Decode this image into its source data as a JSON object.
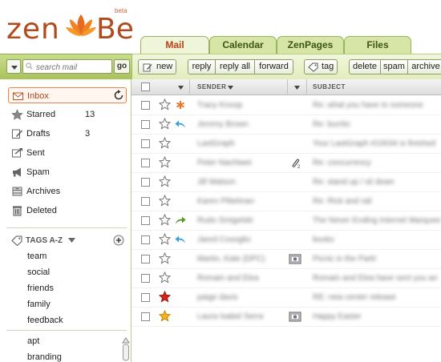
{
  "app": {
    "logo_text_left": "zen",
    "logo_text_right": "Be",
    "logo_badge": "beta",
    "accent_color": "#b5421c",
    "band_color": "#b3ca6a"
  },
  "tabs": [
    {
      "label": "Mail",
      "active": true
    },
    {
      "label": "Calendar",
      "active": false
    },
    {
      "label": "ZenPages",
      "active": false
    },
    {
      "label": "Files",
      "active": false
    }
  ],
  "search": {
    "placeholder": "search mail",
    "go_label": "go"
  },
  "toolbar": {
    "new_label": "new",
    "reply_label": "reply",
    "reply_all_label": "reply all",
    "forward_label": "forward",
    "tag_label": "tag",
    "delete_label": "delete",
    "spam_label": "spam",
    "archive_label": "archive"
  },
  "folders": [
    {
      "label": "Inbox",
      "count": "",
      "icon": "envelope-icon",
      "active": true
    },
    {
      "label": "Starred",
      "count": "13",
      "icon": "star-icon",
      "active": false
    },
    {
      "label": "Drafts",
      "count": "3",
      "icon": "pencil-icon",
      "active": false
    },
    {
      "label": "Sent",
      "count": "",
      "icon": "sent-icon",
      "active": false
    },
    {
      "label": "Spam",
      "count": "",
      "icon": "megaphone-icon",
      "active": false
    },
    {
      "label": "Archives",
      "count": "",
      "icon": "archive-icon",
      "active": false
    },
    {
      "label": "Deleted",
      "count": "",
      "icon": "trash-icon",
      "active": false
    }
  ],
  "tags": {
    "header": "TAGS A-Z",
    "items": [
      "team",
      "social",
      "friends",
      "family",
      "feedback"
    ],
    "more_items": [
      "apt",
      "branding"
    ]
  },
  "columns": {
    "sender": "SENDER",
    "subject": "SUBJECT"
  },
  "messages": [
    {
      "sender": "Tracy Knoop",
      "subject": "Re: what you have to someone",
      "star": "empty",
      "mark": "asterisk",
      "attach": ""
    },
    {
      "sender": "Jeremy Brown",
      "subject": "Re: burrito",
      "star": "empty",
      "mark": "reply",
      "attach": ""
    },
    {
      "sender": "LastGraph",
      "subject": "Your LastGraph #10034 is finished",
      "star": "empty",
      "mark": "",
      "attach": ""
    },
    {
      "sender": "Peter Nachtwei",
      "subject": "Re: concurrency",
      "star": "empty",
      "mark": "",
      "attach": "paperclip"
    },
    {
      "sender": "Jill Watson",
      "subject": "Re: stand up / sit down",
      "star": "empty",
      "mark": "",
      "attach": ""
    },
    {
      "sender": "Karen Pittelman",
      "subject": "Re: Rick and rail",
      "star": "empty",
      "mark": "",
      "attach": ""
    },
    {
      "sender": "Rudo Smigelski",
      "subject": "The Never Ending Internet Marquee",
      "star": "empty",
      "mark": "forward",
      "attach": ""
    },
    {
      "sender": "Jared Cosoglio",
      "subject": "books",
      "star": "empty",
      "mark": "reply",
      "attach": ""
    },
    {
      "sender": "Martin, Kate (DPC)",
      "subject": "Picnic in the Park!",
      "star": "empty",
      "mark": "",
      "attach": "photo"
    },
    {
      "sender": "Romain and Elea",
      "subject": "Romain and Elea have sent you an",
      "star": "empty",
      "mark": "",
      "attach": ""
    },
    {
      "sender": "paige davis",
      "subject": "RE: new center release",
      "star": "red",
      "mark": "",
      "attach": ""
    },
    {
      "sender": "Laura Isabel Serra",
      "subject": "Happy Easter",
      "star": "yellow",
      "mark": "",
      "attach": "photo"
    }
  ]
}
